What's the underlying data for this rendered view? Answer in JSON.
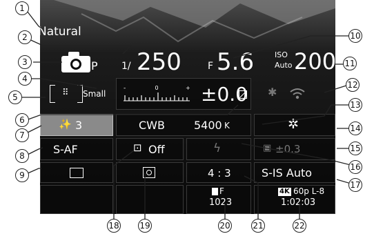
{
  "picture_mode": "Natural",
  "shooting_mode": "P",
  "shutter": {
    "prefix": "1/",
    "value": "250"
  },
  "aperture": {
    "prefix": "F",
    "value": "5.6"
  },
  "iso": {
    "label_top": "ISO",
    "label_bottom": "Auto",
    "value": "200"
  },
  "exposure_comp": {
    "scale_zero": "0",
    "scale_minus": "-",
    "scale_plus": "+",
    "value": "±0.0"
  },
  "af_target": {
    "size": "Small"
  },
  "wb": {
    "label": "CWB",
    "kelvin": "5400",
    "kelvin_unit": "K"
  },
  "art_filter": {
    "value": "3"
  },
  "af_mode": "S-AF",
  "face_priority": "Off",
  "flash_comp": "±0.3",
  "aspect": "4 : 3",
  "quality": {
    "code": "F",
    "count": "1023"
  },
  "movie": {
    "badge": "4K",
    "format": "60p L-8",
    "time": "1:02:03"
  },
  "stabilizer": "S-IS Auto",
  "callouts": [
    "1",
    "2",
    "3",
    "4",
    "5",
    "6",
    "7",
    "8",
    "9",
    "10",
    "11",
    "12",
    "13",
    "14",
    "15",
    "16",
    "17",
    "18",
    "19",
    "20",
    "21",
    "22"
  ],
  "colors": {
    "panel_bg": "#0d0d0d",
    "tile_bg": "#0a0a0a",
    "selected_tile": "#8a8a8a",
    "text": "#ffffff"
  }
}
